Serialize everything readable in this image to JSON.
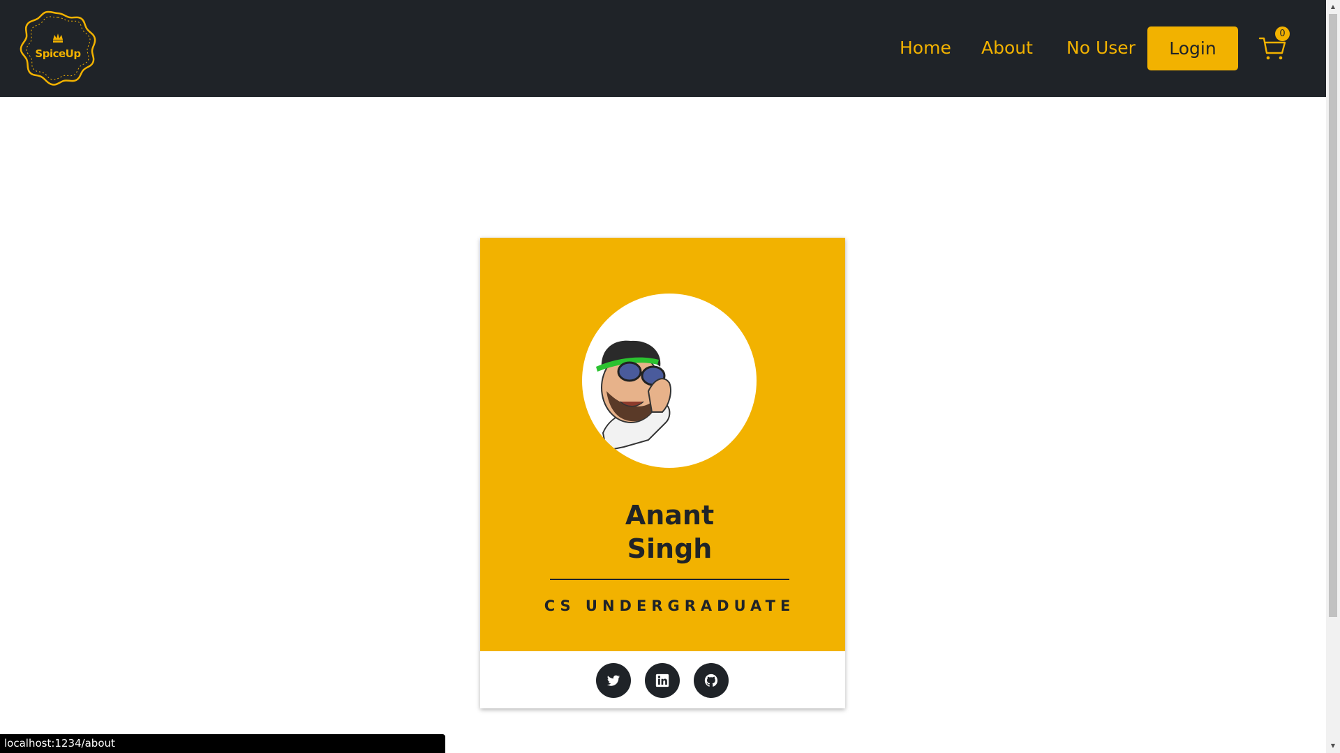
{
  "header": {
    "logo_text": "SpiceUp",
    "nav": {
      "home": "Home",
      "about": "About",
      "user": "No User"
    },
    "login_label": "Login",
    "cart_count": "0"
  },
  "profile": {
    "name_line1": "Anant",
    "name_line2": "Singh",
    "role": "CS UNDERGRADUATE",
    "socials": [
      "twitter-icon",
      "linkedin-icon",
      "github-icon"
    ]
  },
  "statusbar": {
    "url": "localhost:1234/about"
  },
  "colors": {
    "accent": "#f2b200",
    "dark": "#1f2328",
    "background": "#ffffff"
  }
}
